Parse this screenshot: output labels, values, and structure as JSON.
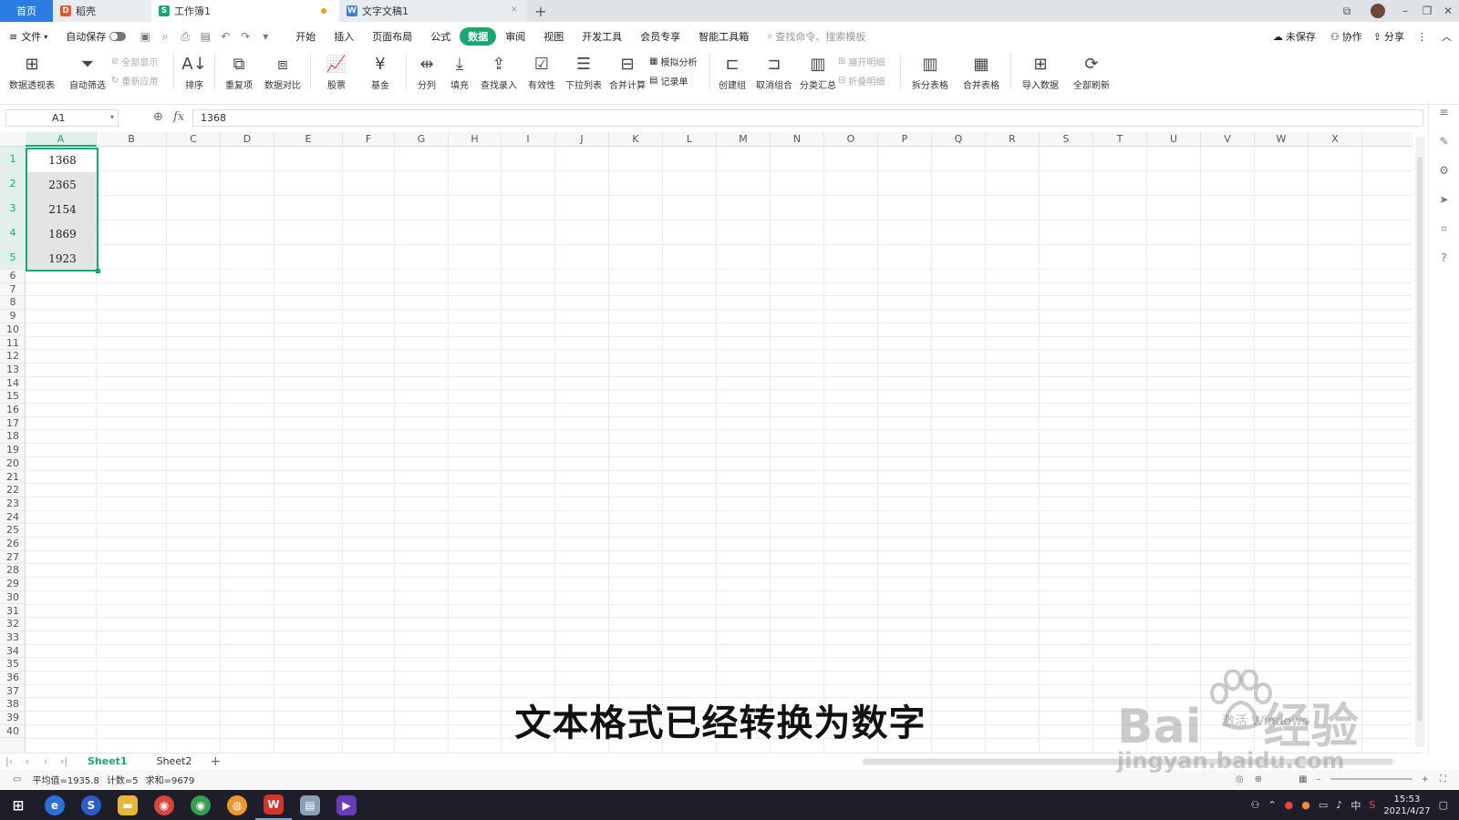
{
  "tabs": {
    "home": "首页",
    "docer": "稻壳",
    "workbook": "工作簿1",
    "document": "文字文稿1"
  },
  "menu": {
    "file": "文件",
    "autosave": "自动保存",
    "items": [
      "开始",
      "插入",
      "页面布局",
      "公式",
      "数据",
      "审阅",
      "视图",
      "开发工具",
      "会员专享",
      "智能工具箱"
    ],
    "active_index": 4,
    "search_placeholder": "查找命令、搜索模板",
    "unsaved": "未保存",
    "collab": "协作",
    "share": "分享"
  },
  "ribbon": {
    "pivot": "数据透视表",
    "autofilter": "自动筛选",
    "show_all": "全部显示",
    "reapply": "重新应用",
    "sort": "排序",
    "duplicates": "重复项",
    "compare": "数据对比",
    "stock": "股票",
    "fund": "基金",
    "split": "分列",
    "fill": "填充",
    "lookup": "查找录入",
    "validity": "有效性",
    "dropdown": "下拉列表",
    "consolidate": "合并计算",
    "whatif": "模拟分析",
    "record": "记录单",
    "group": "创建组",
    "ungroup": "取消组合",
    "subtotal": "分类汇总",
    "expand": "展开明细",
    "collapse": "折叠明细",
    "split_table": "拆分表格",
    "merge_table": "合并表格",
    "import": "导入数据",
    "refresh": "全部刷新"
  },
  "formula_bar": {
    "cell_ref": "A1",
    "fx": "fx",
    "value": "1368"
  },
  "grid": {
    "columns": [
      "A",
      "B",
      "C",
      "D",
      "E",
      "F",
      "G",
      "H",
      "I",
      "J",
      "K",
      "L",
      "M",
      "N",
      "O",
      "P",
      "Q",
      "R",
      "S",
      "T",
      "U",
      "V",
      "W",
      "X"
    ],
    "row_count": 40,
    "cells_A": [
      "1368",
      "2365",
      "2154",
      "1869",
      "1923"
    ]
  },
  "sheets": {
    "items": [
      "Sheet1",
      "Sheet2"
    ],
    "active": "Sheet1"
  },
  "status": {
    "average": "平均值=1935.8",
    "count": "计数=5",
    "sum": "求和=9679"
  },
  "subtitle": "文本格式已经转换为数字",
  "watermark": {
    "brand": "Bai",
    "brand2": "经验",
    "url": "jingyan.baidu.com",
    "activate": "激活 Windows"
  },
  "taskbar": {
    "time": "15:53",
    "date": "2021/4/27",
    "ime": "中"
  },
  "colors": {
    "accent": "#1aa674",
    "home_tab": "#2b7de1",
    "taskbar": "#1e1e2a"
  }
}
